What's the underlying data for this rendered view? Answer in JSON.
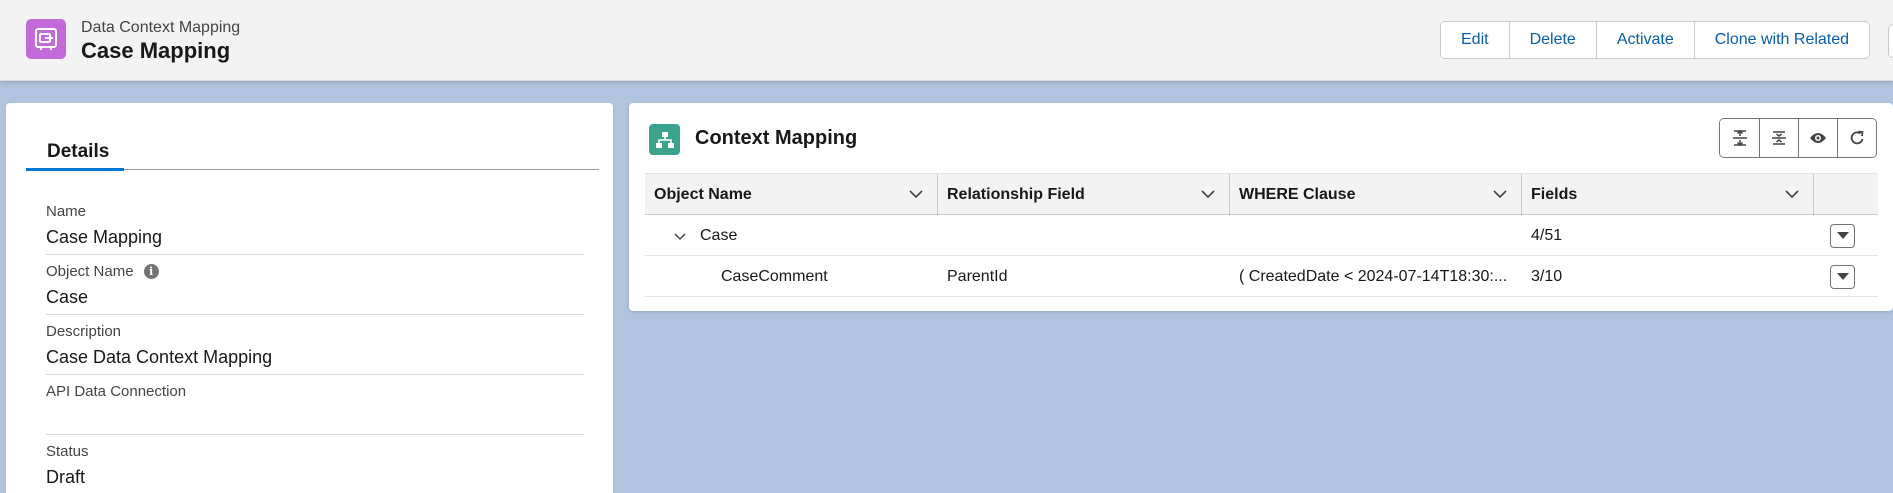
{
  "header": {
    "object_type": "Data Context Mapping",
    "record_title": "Case Mapping",
    "object_icon": "context-mapping-icon",
    "object_icon_color": "#c469d9",
    "actions": [
      "Edit",
      "Delete",
      "Activate",
      "Clone with Related"
    ],
    "action_color": "#0b5cab"
  },
  "details": {
    "tab_label": "Details",
    "fields": [
      {
        "label": "Name",
        "value": "Case Mapping"
      },
      {
        "label": "Object Name",
        "value": "Case",
        "info_icon": "info-icon"
      },
      {
        "label": "Description",
        "value": "Case Data Context Mapping"
      },
      {
        "label": "API Data Connection",
        "value": ""
      },
      {
        "label": "Status",
        "value": "Draft"
      }
    ]
  },
  "context_mapping": {
    "title": "Context Mapping",
    "icon": "hierarchy-icon",
    "icon_color": "#3ba28e",
    "toolbar_icons": [
      "expand-all-icon",
      "collapse-all-icon",
      "preview-icon",
      "refresh-icon"
    ],
    "columns": [
      "Object Name",
      "Relationship Field",
      "WHERE Clause",
      "Fields"
    ],
    "rows": [
      {
        "object_name": "Case",
        "relationship_field": "",
        "where_clause": "",
        "fields": "4/51",
        "expanded": true,
        "level": 1
      },
      {
        "object_name": "CaseComment",
        "relationship_field": "ParentId",
        "where_clause": "( CreatedDate < 2024-07-14T18:30:...",
        "fields": "3/10",
        "level": 2
      }
    ]
  }
}
